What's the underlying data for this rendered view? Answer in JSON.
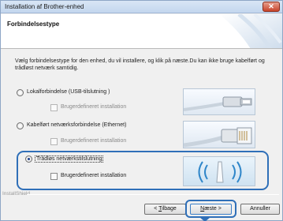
{
  "window": {
    "title": "Installation af Brother-enhed",
    "close_symbol": "✕"
  },
  "header": {
    "heading": "Forbindelsestype"
  },
  "description": "Vælg forbindelsestype for den enhed, du vil installere, og klik på næste.Du kan ikke bruge kabelført og trådløst netværk samtidig.",
  "options": [
    {
      "label": "Lokalforbindelse (USB-tilslutning )",
      "selected": false,
      "custom_install": {
        "label": "Brugerdefineret installation",
        "enabled": false,
        "checked": false
      },
      "icon": "usb-cable-icon"
    },
    {
      "label": "Kabelført netværksforbindelse (Ethernet)",
      "selected": false,
      "custom_install": {
        "label": "Brugerdefineret installation",
        "enabled": false,
        "checked": false
      },
      "icon": "ethernet-cable-icon"
    },
    {
      "label": "Trådløs netværkstilslutning",
      "selected": true,
      "custom_install": {
        "label": "Brugerdefineret installation",
        "enabled": true,
        "checked": false
      },
      "icon": "wireless-signal-icon"
    }
  ],
  "footer": {
    "brand": "InstallShield",
    "back_prefix": "< ",
    "back_key": "T",
    "back_rest": "ilbage",
    "next_key": "N",
    "next_rest": "æste >",
    "cancel": "Annuller"
  },
  "colors": {
    "highlight": "#2f6fb8",
    "titlebar": "#c3d6ee",
    "accent": "#1b3f8b"
  }
}
